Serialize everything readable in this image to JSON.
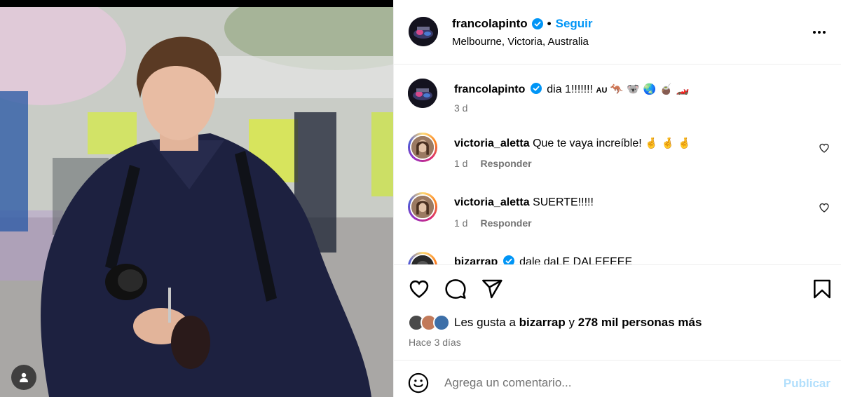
{
  "post": {
    "author": "francolapinto",
    "follow_label": "Seguir",
    "separator": "•",
    "location": "Melbourne, Victoria, Australia"
  },
  "caption": {
    "user": "francolapinto",
    "text": "dia 1!!!!!!!",
    "au_text": "AU",
    "emojis": "🦘 🐨 🌏 🧉 🏎️",
    "time": "3 d"
  },
  "comments": [
    {
      "user": "victoria_aletta",
      "text": "Que te vaya increíble!",
      "emojis": "🤞 🤞 🤞",
      "time": "1 d",
      "reply_label": "Responder"
    },
    {
      "user": "victoria_aletta",
      "text": "SUERTE!!!!!",
      "emojis": "",
      "time": "1 d",
      "reply_label": "Responder"
    },
    {
      "user": "bizarrap",
      "text": "dale daLE DALEEEEE",
      "emojis": "",
      "time": "",
      "reply_label": ""
    }
  ],
  "likes": {
    "prefix": "Les gusta a",
    "user": "bizarrap",
    "middle": "y",
    "others": "278 mil personas más"
  },
  "time_ago": "Hace 3 días",
  "comment_box": {
    "placeholder": "Agrega un comentario...",
    "publish_label": "Publicar"
  },
  "icons": {
    "verified": "verified-badge-icon",
    "more": "more-options-icon",
    "heart": "heart-icon",
    "comment": "comment-icon",
    "share": "share-icon",
    "save": "bookmark-icon",
    "emoji": "emoji-icon",
    "user_tag": "user-tag-icon"
  },
  "colors": {
    "accent": "#0095f6",
    "verified": "#0095f6",
    "muted": "#737373",
    "publish_disabled": "#b2dffc",
    "border": "#efefef"
  }
}
